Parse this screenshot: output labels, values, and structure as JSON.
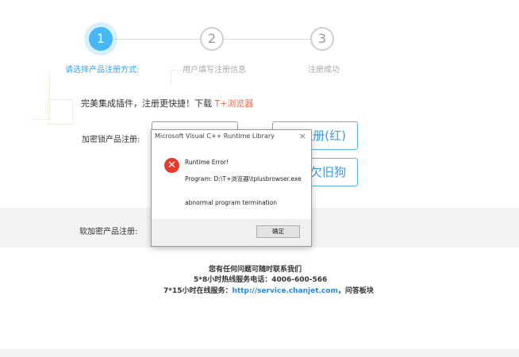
{
  "steps": [
    {
      "number": "1",
      "label": "请选择产品注册方式:"
    },
    {
      "number": "2",
      "label": "用户填写注册信息"
    },
    {
      "number": "3",
      "label": "注册成功"
    }
  ],
  "promo": {
    "text": "完美集成插件，注册更快捷！下载 ",
    "link": "T+浏览器"
  },
  "hardware": {
    "label": "加密锁产品注册:",
    "button_red": "注册(红)",
    "button_old": "欠旧狗"
  },
  "software": {
    "label": "软加密产品注册:"
  },
  "contact": {
    "line1": "您有任何问题可随时联系我们",
    "line2": "5*8小时热线服务电话：4006-600-566",
    "line3_prefix": "7*15小时在线服务：",
    "line3_url": "http://service.chanjet.com",
    "line3_suffix": "，问答板块"
  },
  "dialog": {
    "title": "Microsoft Visual C++ Runtime Library",
    "close": "×",
    "icon": "error-x-icon",
    "error_title": "Runtime Error!",
    "program": "Program: D:\\T+浏览器\\tplusbrowser.exe",
    "message": "abnormal program termination",
    "ok": "确定"
  },
  "colors": {
    "accent": "#48b8f5",
    "link_red": "#f06a4a",
    "error_red": "#e43b2f"
  }
}
